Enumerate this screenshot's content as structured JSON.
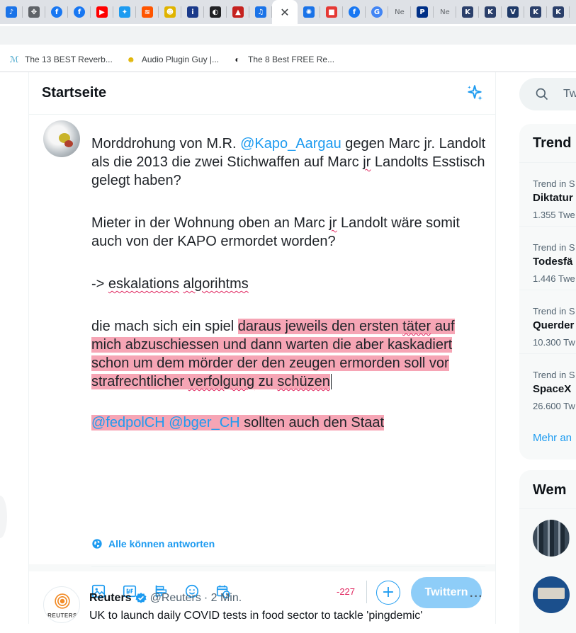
{
  "tabs": [
    {
      "icon": "soundcloud-tab-icon",
      "color": "#1a73e8",
      "glyph": "♪"
    },
    {
      "icon": "puzzle-tab-icon",
      "color": "#5f6368",
      "glyph": "✥"
    },
    {
      "icon": "facebook-tab-icon",
      "color": "#1877f2",
      "glyph": "f"
    },
    {
      "icon": "facebook-tab-icon",
      "color": "#1877f2",
      "glyph": "f"
    },
    {
      "icon": "youtube-tab-icon",
      "color": "#ff0000",
      "glyph": "▶"
    },
    {
      "icon": "twitter-tab-icon",
      "color": "#1d9bf0",
      "glyph": "✦"
    },
    {
      "icon": "soundcloud-tab-icon",
      "color": "#ff5500",
      "glyph": "≋"
    },
    {
      "icon": "plugin-guy-tab-icon",
      "color": "#e0b400",
      "glyph": "☻"
    },
    {
      "icon": "info-tab-icon",
      "color": "#1a3a8a",
      "glyph": "i"
    },
    {
      "icon": "moon-tab-icon",
      "color": "#202124",
      "glyph": "◐"
    },
    {
      "icon": "warning-tab-icon",
      "color": "#c5221f",
      "glyph": "▲"
    },
    {
      "icon": "music-tab-icon",
      "color": "#1a73e8",
      "glyph": "♫"
    },
    {
      "icon": "settings-tab-icon",
      "color": "#1a73e8",
      "glyph": "✺"
    },
    {
      "icon": "gradient-tab-icon",
      "color": "#e53935",
      "glyph": "■"
    },
    {
      "icon": "facebook-tab-icon",
      "color": "#1877f2",
      "glyph": "f"
    },
    {
      "icon": "google-tab-icon",
      "color": "#4285f4",
      "glyph": "G"
    },
    {
      "icon": "new-tab-icon",
      "label": "Ne"
    },
    {
      "icon": "paypal-tab-icon",
      "color": "#003087",
      "glyph": "P"
    },
    {
      "icon": "new-tab-icon",
      "label": "Ne"
    },
    {
      "icon": "ks-tab-icon",
      "color": "#2a3f6a",
      "glyph": "K"
    },
    {
      "icon": "ks-tab-icon",
      "color": "#2a3f6a",
      "glyph": "K"
    },
    {
      "icon": "vv-tab-icon",
      "color": "#1f3a68",
      "glyph": "V"
    },
    {
      "icon": "ks-tab-icon",
      "color": "#2a3f6a",
      "glyph": "K"
    },
    {
      "icon": "ks-tab-icon",
      "color": "#2a3f6a",
      "glyph": "K"
    }
  ],
  "bookmarks": [
    {
      "label": "The 13 BEST Reverb...",
      "glyph": "ℳ",
      "color": "#3aa0c8"
    },
    {
      "label": "Audio Plugin Guy |...",
      "glyph": "☻",
      "color": "#e0b400"
    },
    {
      "label": "The 8 Best FREE Re...",
      "glyph": "◐",
      "color": "#202124"
    }
  ],
  "header": {
    "title": "Startseite"
  },
  "composer": {
    "p1_a": "Morddrohung von M.R. ",
    "p1_mention": "@Kapo_Aargau",
    "p1_b": " gegen Marc jr. Landolt als die 2013 die zwei Stichwaffen auf Marc ",
    "p1_jr": "jr",
    "p1_c": " Landolts Esstisch gelegt haben?",
    "p2_a": "Mieter in der Wohnung oben an Marc ",
    "p2_jr": "jr",
    "p2_b": " Landolt wäre somit auch von der KAPO ermordet worden?",
    "p3_a": "-> ",
    "p3_w1": "eskalations",
    "p3_sp": " ",
    "p3_w2": "algorihtms",
    "p4_a": "die mach sich ein spiel ",
    "p4_h1": "daraus jeweils den ersten ",
    "p4_taeter": "täter",
    "p4_h2": " auf mich abzuschiessen und dann warten die aber kaskadiert schon um dem mörder der den zeugen ermorden soll vor strafrechtlicher ",
    "p4_verfolgung": "verfolgung",
    "p4_h3": " zu ",
    "p4_schuezen": "schüzen",
    "p5_m1": "@fedpolCH",
    "p5_sp": " ",
    "p5_m2": "@bger_CH",
    "p5_b": " sollten auch den Staat",
    "reply_setting": "Alle können antworten",
    "char_counter": "-227",
    "tweet_button": "Twittern"
  },
  "feed": {
    "logo_text": "REUTERS",
    "name": "Reuters",
    "handle": "@Reuters",
    "time": "· 2 Min.",
    "body": "UK to launch daily COVID tests in food sector to tackle 'pingdemic'"
  },
  "search": {
    "placeholder": "Tw"
  },
  "trends": {
    "title": "Trend",
    "items": [
      {
        "context": "Trend in S",
        "name": "Diktatur",
        "count": "1.355 Twe"
      },
      {
        "context": "Trend in S",
        "name": "Todesfä",
        "count": "1.446 Twe"
      },
      {
        "context": "Trend in S",
        "name": "Querder",
        "count": "10.300 Tw"
      },
      {
        "context": "Trend in S",
        "name": "SpaceX",
        "count": "26.600 Tw"
      }
    ],
    "more": "Mehr an"
  },
  "who_to_follow": {
    "title": "Wem"
  },
  "colors": {
    "accent": "#1d9bf0",
    "highlight": "#f6a5b5",
    "warning": "#e0245e",
    "button_disabled": "#8ecdf8"
  }
}
